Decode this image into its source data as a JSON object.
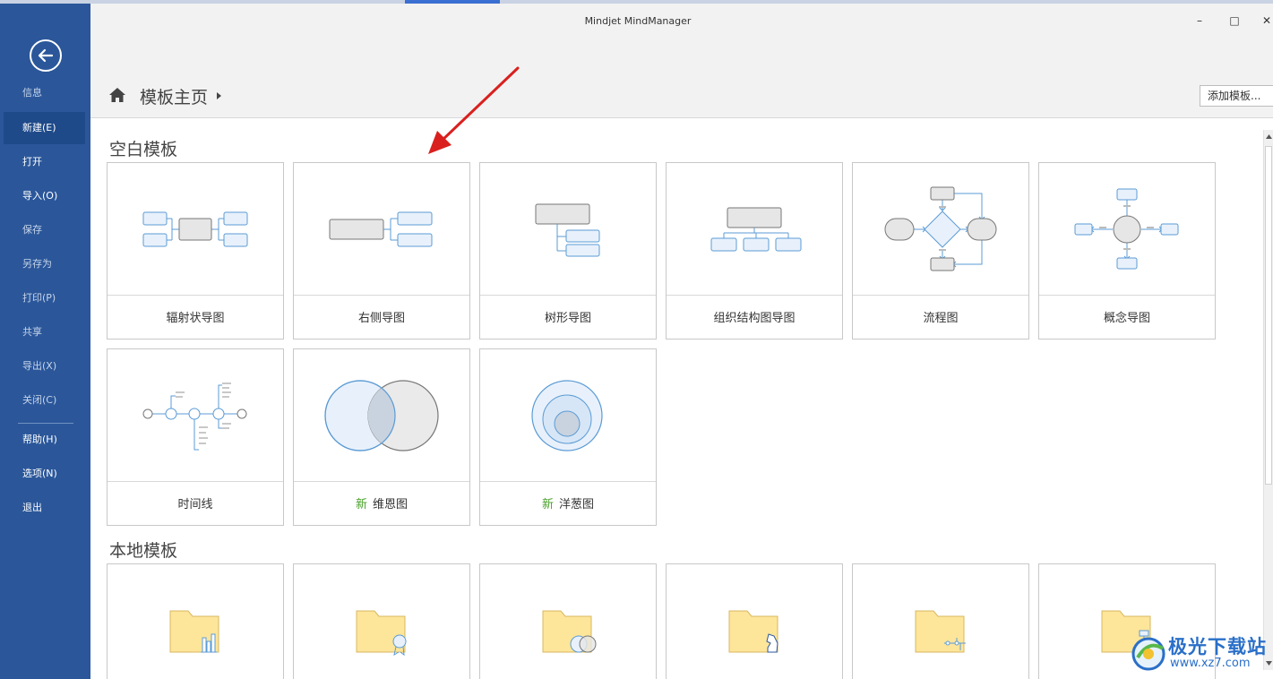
{
  "window": {
    "title": "Mindjet MindManager",
    "minimize_label": "–",
    "maximize_label": "□",
    "close_label": "✕"
  },
  "sidebar": {
    "items": [
      {
        "label": "信息"
      },
      {
        "label": "新建(E)"
      },
      {
        "label": "打开"
      },
      {
        "label": "导入(O)"
      },
      {
        "label": "保存"
      },
      {
        "label": "另存为"
      },
      {
        "label": "打印(P)"
      },
      {
        "label": "共享"
      },
      {
        "label": "导出(X)"
      },
      {
        "label": "关闭(C)"
      },
      {
        "label": "帮助(H)"
      },
      {
        "label": "选项(N)"
      },
      {
        "label": "退出"
      }
    ]
  },
  "header": {
    "breadcrumb": "模板主页",
    "add_template_button": "添加模板..."
  },
  "sections": {
    "blank": {
      "title": "空白模板",
      "cards": [
        {
          "label": "辐射状导图",
          "new": ""
        },
        {
          "label": "右侧导图",
          "new": ""
        },
        {
          "label": "树形导图",
          "new": ""
        },
        {
          "label": "组织结构图导图",
          "new": ""
        },
        {
          "label": "流程图",
          "new": ""
        },
        {
          "label": "概念导图",
          "new": ""
        },
        {
          "label": "时间线",
          "new": ""
        },
        {
          "label": "维恩图",
          "new": "新"
        },
        {
          "label": "洋葱图",
          "new": "新"
        }
      ]
    },
    "local": {
      "title": "本地模板"
    }
  },
  "watermark": {
    "name": "极光下载站",
    "url": "www.xz7.com"
  },
  "colors": {
    "sidebar": "#2b579a",
    "sidebar_active": "#1f4a8a",
    "new_tag": "#4aa12a",
    "shape_blue": "#5b9bd5",
    "shape_blue_fill": "#e8f1fb",
    "shape_gray_fill": "#e6e6e6",
    "annotation_arrow": "#d9201e",
    "folder": "#fde59a"
  }
}
